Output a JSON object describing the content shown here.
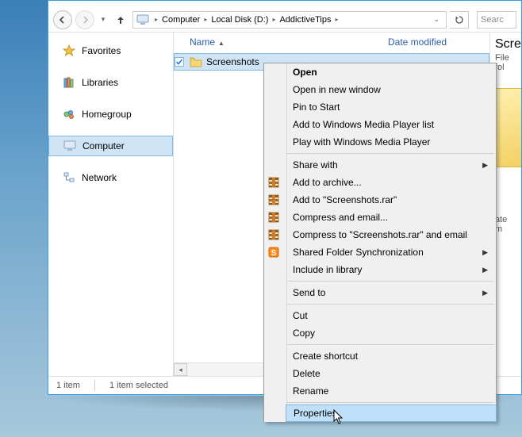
{
  "breadcrumb": {
    "root_icon": "computer",
    "parts": [
      "Computer",
      "Local Disk (D:)",
      "AddictiveTips"
    ]
  },
  "search": {
    "placeholder": "Searc"
  },
  "sidebar": {
    "items": [
      {
        "label": "Favorites",
        "icon": "star"
      },
      {
        "label": "Libraries",
        "icon": "libraries"
      },
      {
        "label": "Homegroup",
        "icon": "homegroup"
      },
      {
        "label": "Computer",
        "icon": "computer",
        "selected": true
      },
      {
        "label": "Network",
        "icon": "network"
      }
    ]
  },
  "columns": {
    "name": "Name",
    "modified": "Date modified"
  },
  "items": [
    {
      "name": "Screenshots",
      "type": "folder",
      "selected": true
    }
  ],
  "details": {
    "title": "Scree",
    "sub": "File fol",
    "date_label": "ate m"
  },
  "status": {
    "count": "1 item",
    "selection": "1 item selected"
  },
  "context_menu": {
    "groups": [
      [
        {
          "label": "Open",
          "bold": true
        },
        {
          "label": "Open in new window"
        },
        {
          "label": "Pin to Start"
        },
        {
          "label": "Add to Windows Media Player list"
        },
        {
          "label": "Play with Windows Media Player"
        }
      ],
      [
        {
          "label": "Share with",
          "submenu": true
        },
        {
          "label": "Add to archive...",
          "icon": "archive"
        },
        {
          "label": "Add to \"Screenshots.rar\"",
          "icon": "archive"
        },
        {
          "label": "Compress and email...",
          "icon": "archive"
        },
        {
          "label": "Compress to \"Screenshots.rar\" and email",
          "icon": "archive"
        },
        {
          "label": "Shared Folder Synchronization",
          "submenu": true,
          "icon": "sync"
        },
        {
          "label": "Include in library",
          "submenu": true
        }
      ],
      [
        {
          "label": "Send to",
          "submenu": true
        }
      ],
      [
        {
          "label": "Cut"
        },
        {
          "label": "Copy"
        }
      ],
      [
        {
          "label": "Create shortcut"
        },
        {
          "label": "Delete"
        },
        {
          "label": "Rename"
        }
      ],
      [
        {
          "label": "Properties",
          "highlight": true
        }
      ]
    ]
  }
}
